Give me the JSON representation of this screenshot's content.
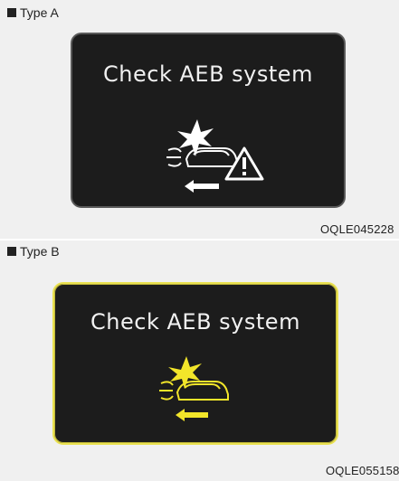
{
  "panel_a": {
    "type_label": "Type A",
    "screen_text": "Check AEB system",
    "code": "OQLE045228",
    "icon": "aeb-collision-warning-icon",
    "icon_color": "#ffffff"
  },
  "panel_b": {
    "type_label": "Type B",
    "screen_text": "Check AEB system",
    "code": "OQLE055158",
    "icon": "aeb-collision-icon",
    "icon_color": "#f2e52a",
    "border_color": "#e9e150"
  }
}
